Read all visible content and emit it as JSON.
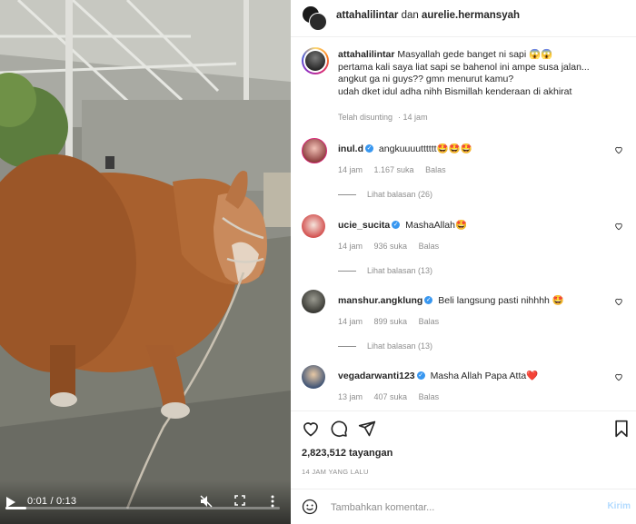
{
  "video": {
    "time_display": "0:01 / 0:13",
    "progress_fraction": 0.077,
    "play_icon": "play-icon",
    "mute_icon": "volume-muted-icon",
    "fullscreen_icon": "fullscreen-icon",
    "more_icon": "more-vertical-icon"
  },
  "header": {
    "user1": "attahalilintar",
    "joiner": "dan",
    "user2": "aurelie.hermansyah"
  },
  "caption": {
    "username": "attahalilintar",
    "lines": [
      "Masyallah gede banget ni sapi 😱😱",
      "pertama kali saya liat sapi se bahenol ini ampe susa jalan...",
      "angkut ga ni guys?? gmn menurut kamu?",
      "udah dket idul adha nihh Bismillah kenderaan di akhirat"
    ],
    "edited_label": "Telah disunting",
    "age": "14 jam"
  },
  "comments": [
    {
      "username": "inul.d",
      "verified": true,
      "text": "angkuuuutttttt🤩🤩🤩",
      "age": "14 jam",
      "likes": "1.167 suka",
      "reply_label": "Balas",
      "view_replies": "Lihat balasan (26)",
      "avatar_color": "#b36a6a"
    },
    {
      "username": "ucie_sucita",
      "verified": true,
      "text": "MashaAllah🤩",
      "age": "14 jam",
      "likes": "936 suka",
      "reply_label": "Balas",
      "view_replies": "Lihat balasan (13)",
      "avatar_color": "#e8d8d2"
    },
    {
      "username": "manshur.angklung",
      "verified": true,
      "text": "Beli langsung pasti nihhhh 🤩",
      "age": "14 jam",
      "likes": "899 suka",
      "reply_label": "Balas",
      "view_replies": "Lihat balasan (13)",
      "avatar_color": "#5a5a52"
    },
    {
      "username": "vegadarwanti123",
      "verified": true,
      "text": "Masha Allah Papa Atta❤️",
      "age": "13 jam",
      "likes": "407 suka",
      "reply_label": "Balas",
      "view_replies": "",
      "avatar_color": "#4a6080"
    }
  ],
  "actions": {
    "like_icon": "heart-icon",
    "comment_icon": "comment-icon",
    "share_icon": "share-icon",
    "save_icon": "bookmark-icon",
    "views": "2,823,512 tayangan",
    "date": "14 JAM YANG LALU"
  },
  "add_comment": {
    "placeholder": "Tambahkan komentar...",
    "send_label": "Kirim",
    "emoji_icon": "emoji-icon"
  },
  "colors": {
    "accent": "#0095f6",
    "verified": "#3897f0",
    "muted_text": "#8e8e8e",
    "send_disabled": "#b3dbff"
  }
}
